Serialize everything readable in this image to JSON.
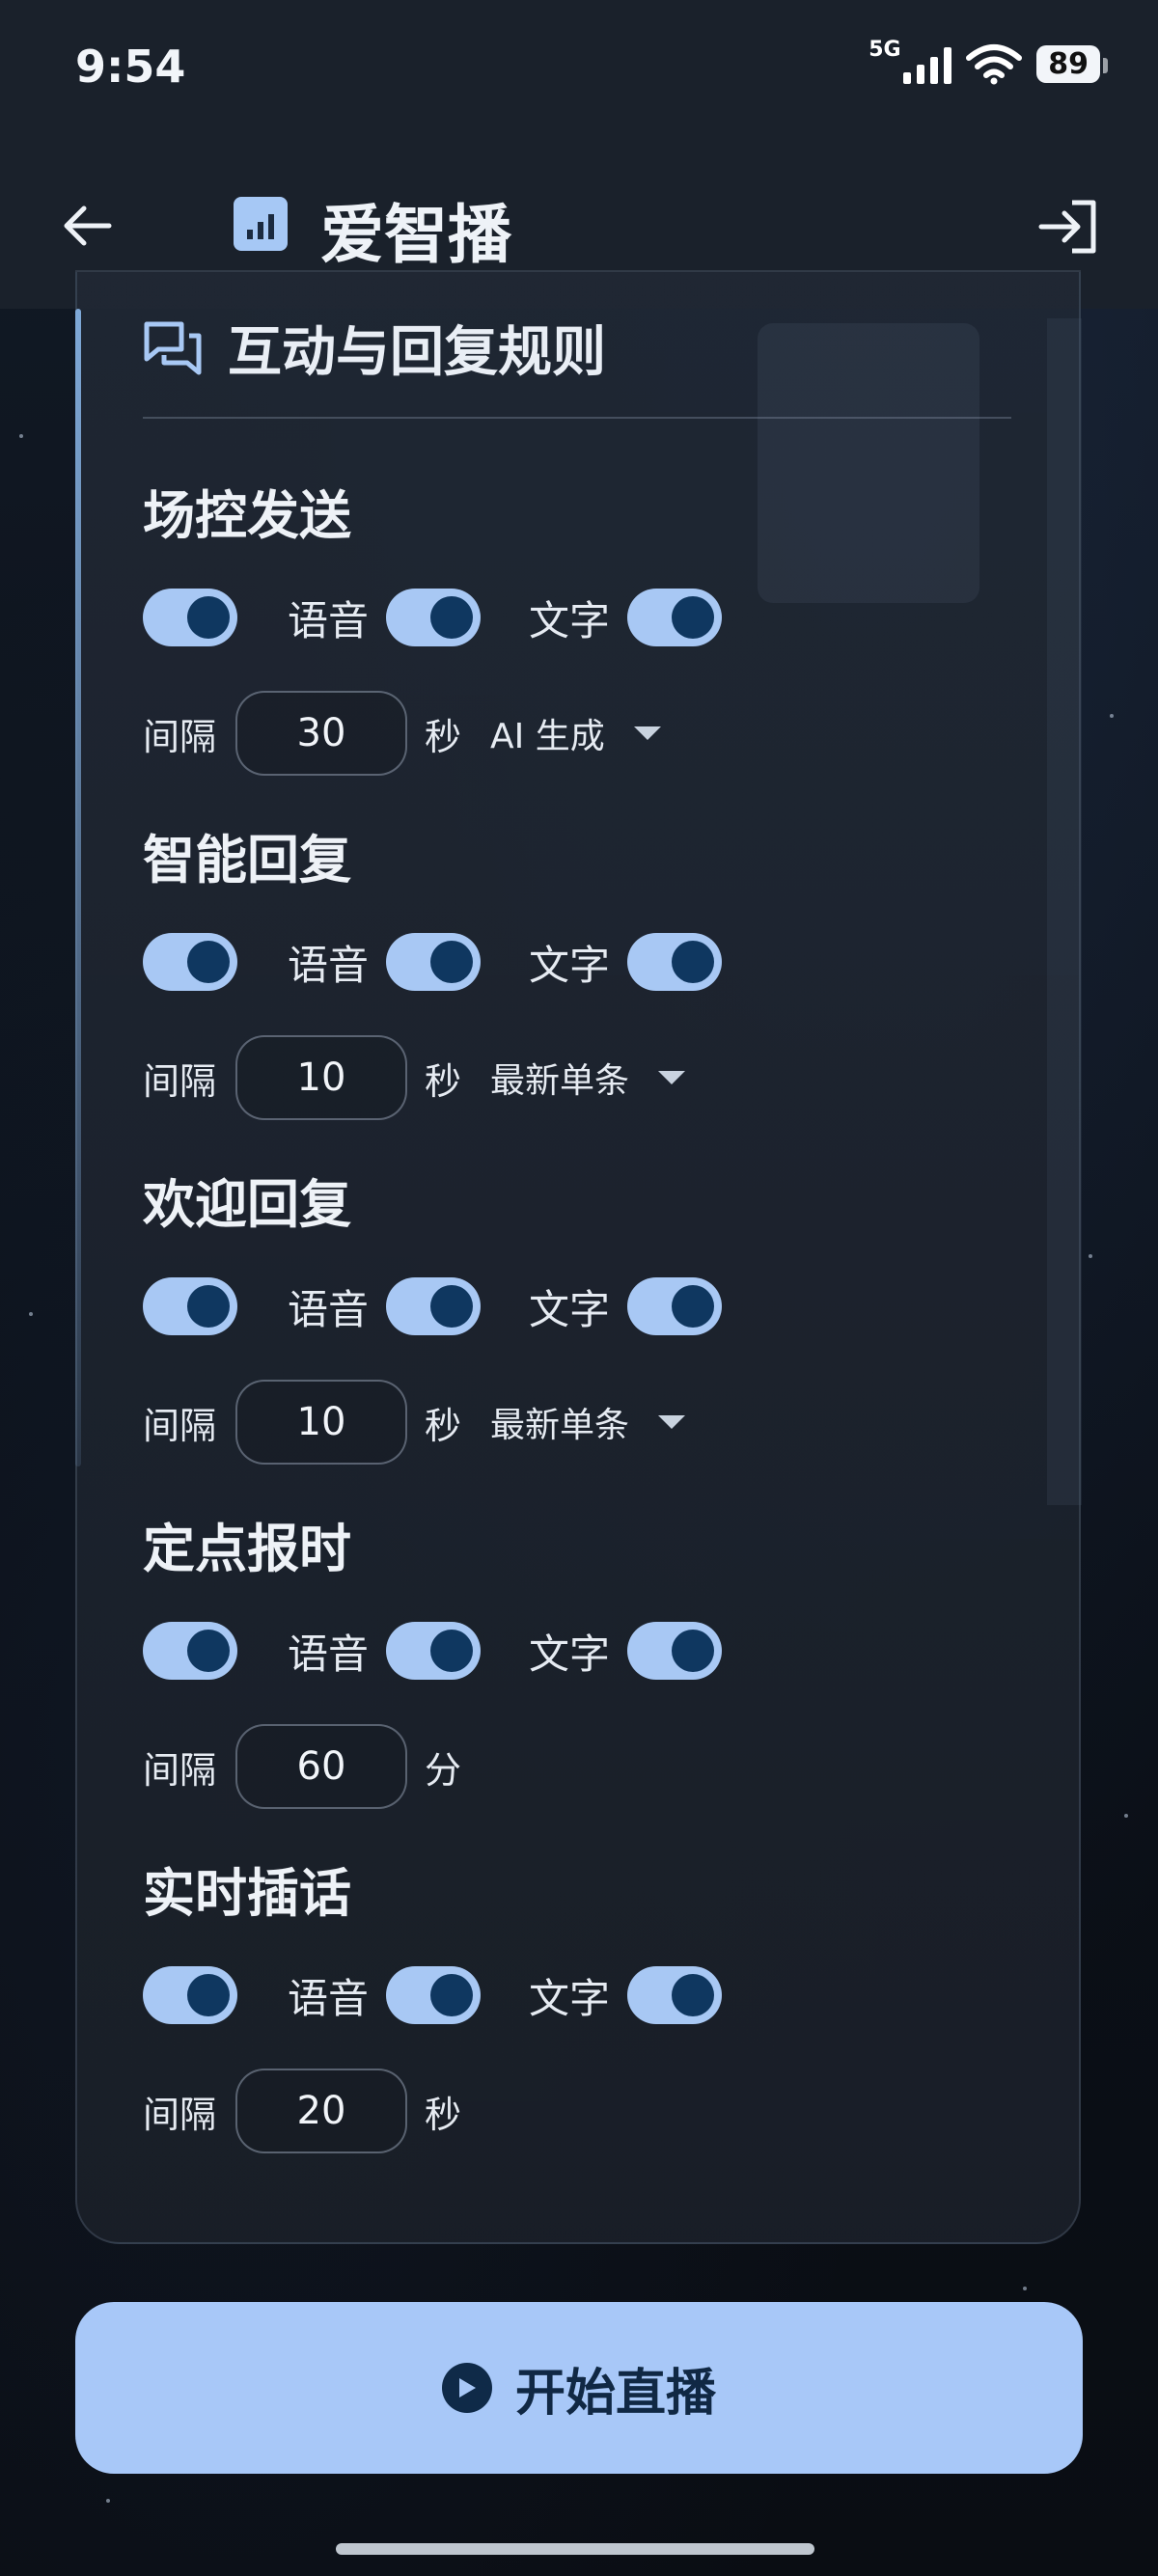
{
  "status_bar": {
    "time": "9:54",
    "network": "5G",
    "battery": "89"
  },
  "app_bar": {
    "title": "爱智播",
    "back_icon": "arrow-left-icon",
    "logo_icon": "bar-chart-icon",
    "action_icon": "login-icon"
  },
  "card": {
    "title": "互动与回复规则",
    "icon": "chat-bubbles-icon"
  },
  "sections": [
    {
      "title": "场控发送",
      "toggles": {
        "main": true,
        "voice_label": "语音",
        "voice": true,
        "text_label": "文字",
        "text": true
      },
      "interval_label": "间隔",
      "interval_value": "30",
      "unit": "秒",
      "mode": "AI 生成"
    },
    {
      "title": "智能回复",
      "toggles": {
        "main": true,
        "voice_label": "语音",
        "voice": true,
        "text_label": "文字",
        "text": true
      },
      "interval_label": "间隔",
      "interval_value": "10",
      "unit": "秒",
      "mode": "最新单条"
    },
    {
      "title": "欢迎回复",
      "toggles": {
        "main": true,
        "voice_label": "语音",
        "voice": true,
        "text_label": "文字",
        "text": true
      },
      "interval_label": "间隔",
      "interval_value": "10",
      "unit": "秒",
      "mode": "最新单条"
    },
    {
      "title": "定点报时",
      "toggles": {
        "main": true,
        "voice_label": "语音",
        "voice": true,
        "text_label": "文字",
        "text": true
      },
      "interval_label": "间隔",
      "interval_value": "60",
      "unit": "分"
    },
    {
      "title": "实时插话",
      "toggles": {
        "main": true,
        "voice_label": "语音",
        "voice": true,
        "text_label": "文字",
        "text": true
      },
      "interval_label": "间隔",
      "interval_value": "20",
      "unit": "秒"
    }
  ],
  "start_button": {
    "label": "开始直播",
    "icon": "play-circle-icon"
  },
  "colors": {
    "accent": "#a8c8f8",
    "knob": "#0f3760",
    "surface": "#1a212b",
    "button_text": "#102844"
  }
}
